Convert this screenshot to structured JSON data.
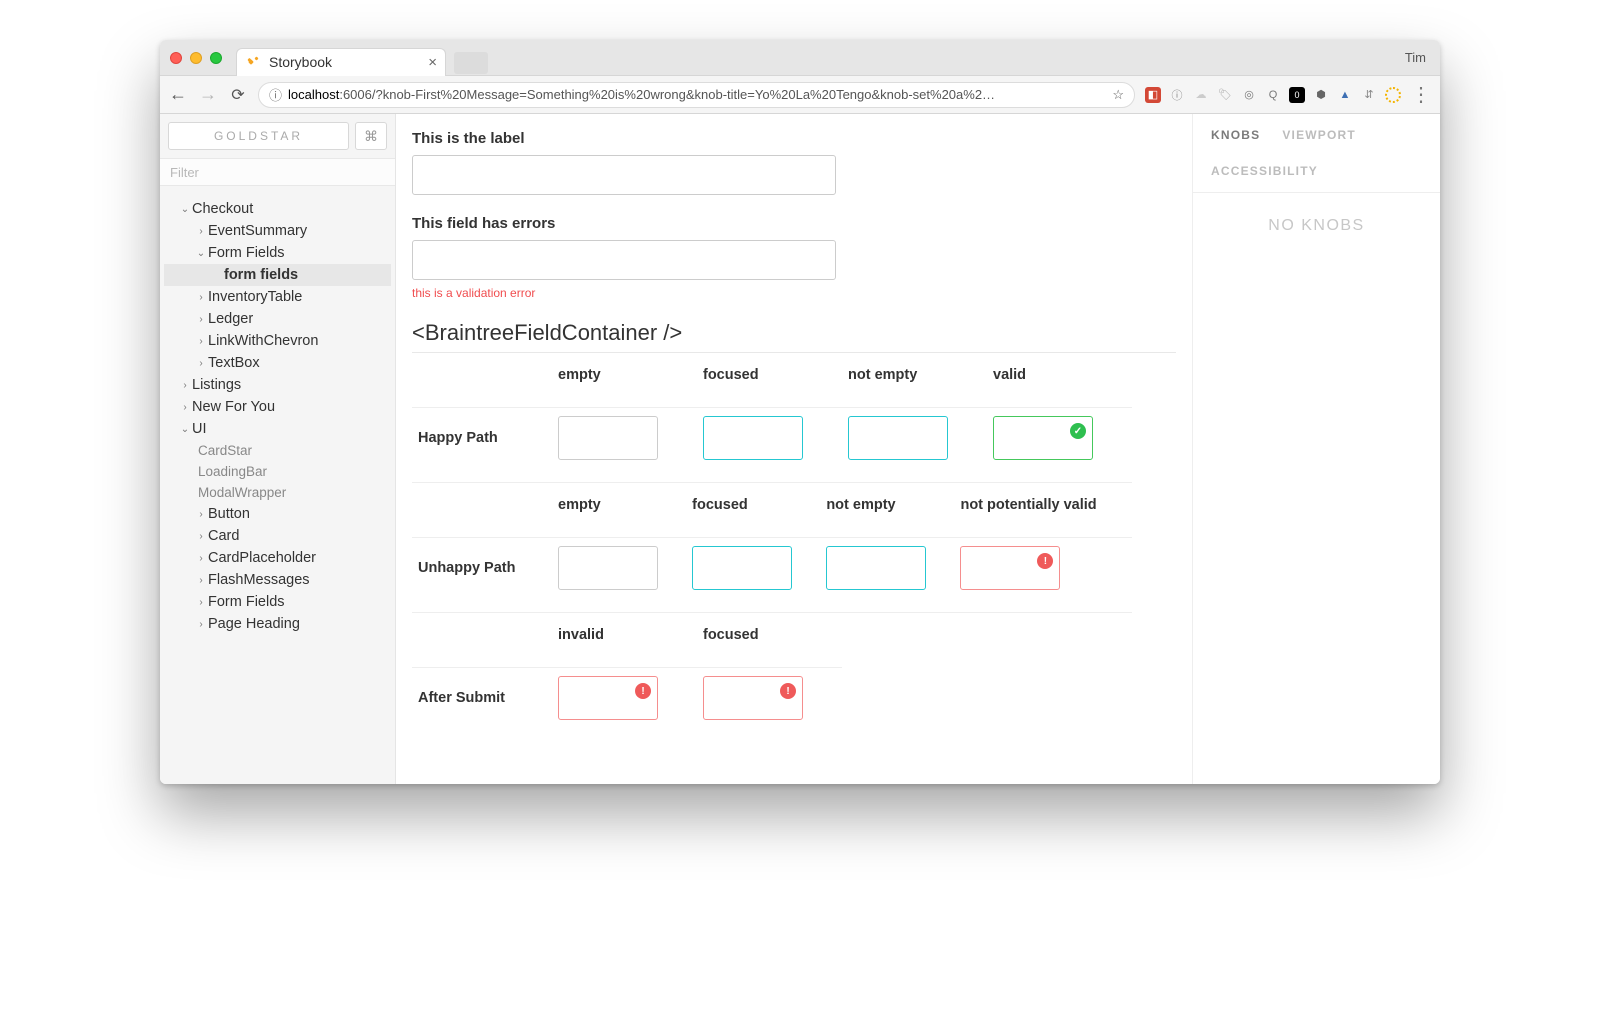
{
  "browser": {
    "tab_title": "Storybook",
    "profile_name": "Tim",
    "url_host": "localhost",
    "url_port": ":6006",
    "url_rest": "/?knob-First%20Message=Something%20is%20wrong&knob-title=Yo%20La%20Tengo&knob-set%20a%2…"
  },
  "sidebar": {
    "title_button": "GOLDSTAR",
    "cmd_glyph": "⌘",
    "filter_placeholder": "Filter",
    "tree": {
      "checkout": "Checkout",
      "eventsummary": "EventSummary",
      "formfields_folder": "Form Fields",
      "formfields_leaf": "form fields",
      "inventorytable": "InventoryTable",
      "ledger": "Ledger",
      "linkwithchevron": "LinkWithChevron",
      "textbox": "TextBox",
      "listings": "Listings",
      "newforyou": "New For You",
      "ui": "UI",
      "cardstar": "CardStar",
      "loadingbar": "LoadingBar",
      "modalwrapper": "ModalWrapper",
      "button": "Button",
      "card": "Card",
      "cardplaceholder": "CardPlaceholder",
      "flashmessages": "FlashMessages",
      "formfields2": "Form Fields",
      "pageheading": "Page Heading"
    }
  },
  "preview": {
    "label1": "This is the label",
    "label2": "This field has errors",
    "error_msg": "this is a validation error",
    "section_heading": "<BraintreeFieldContainer />",
    "tables": {
      "happy": {
        "rowname": "Happy Path",
        "headers": [
          "empty",
          "focused",
          "not empty",
          "valid"
        ]
      },
      "unhappy": {
        "rowname": "Unhappy Path",
        "headers": [
          "empty",
          "focused",
          "not empty",
          "not potentially valid"
        ]
      },
      "after": {
        "rowname": "After Submit",
        "headers": [
          "invalid",
          "focused"
        ]
      }
    }
  },
  "addons": {
    "tab_knobs": "KNOBS",
    "tab_viewport": "VIEWPORT",
    "tab_a11y": "ACCESSIBILITY",
    "empty_msg": "NO KNOBS"
  }
}
